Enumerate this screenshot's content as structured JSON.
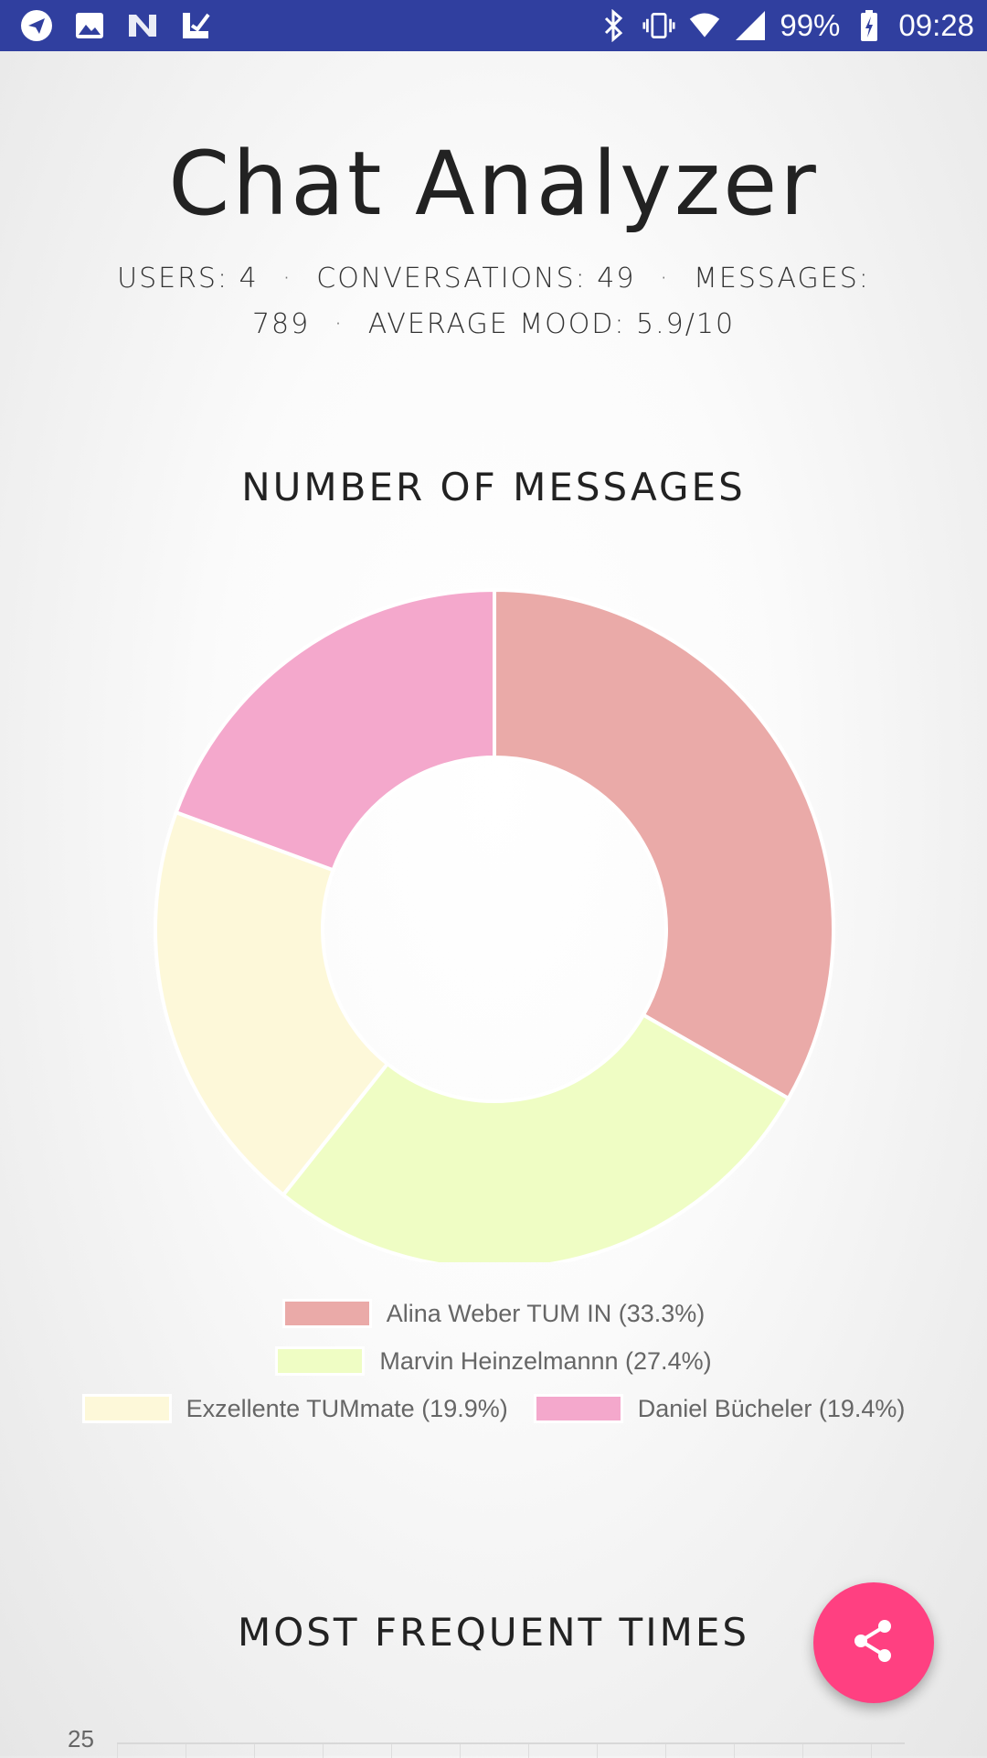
{
  "status_bar": {
    "left_icons": [
      "telegram-icon",
      "image-icon",
      "n-app-icon",
      "checkmark-app-icon"
    ],
    "right_icons": [
      "bluetooth-icon",
      "vibrate-icon",
      "wifi-icon",
      "signal-icon",
      "battery-charging-icon"
    ],
    "battery": "99%",
    "time": "09:28"
  },
  "header": {
    "title": "Chat Analyzer",
    "users": "USERS: 4",
    "conversations": "CONVERSATIONS: 49",
    "messages_label": "MESSAGES:",
    "messages_value": "789",
    "average_mood": "AVERAGE MOOD: 5.9/10",
    "separator": "·"
  },
  "section_messages": {
    "title": "NUMBER OF MESSAGES"
  },
  "chart_data": {
    "type": "pie",
    "donut": true,
    "title": "NUMBER OF MESSAGES",
    "legend_placement": "bottom",
    "slices": [
      {
        "name": "Alina Weber TUM IN",
        "value": 33.3,
        "label": "Alina Weber TUM IN (33.3%)",
        "color": "#eaaaa8"
      },
      {
        "name": "Marvin Heinzelmannn",
        "value": 27.4,
        "label": "Marvin Heinzelmannn (27.4%)",
        "color": "#effdc4"
      },
      {
        "name": "Exzellente TUMmate",
        "value": 19.9,
        "label": "Exzellente TUMmate (19.9%)",
        "color": "#fdf8d9"
      },
      {
        "name": "Daniel Bücheler",
        "value": 19.4,
        "label": "Daniel Bücheler (19.4%)",
        "color": "#f4a8cc"
      }
    ]
  },
  "section_times": {
    "title": "MOST FREQUENT TIMES",
    "y_tick_top": "25"
  },
  "fab": {
    "icon": "share-icon",
    "color": "#ff4081"
  }
}
